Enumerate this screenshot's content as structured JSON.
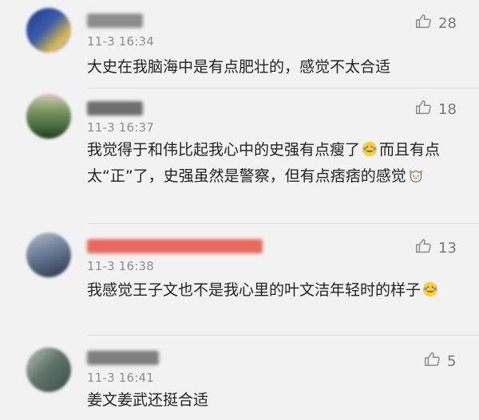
{
  "comments": [
    {
      "timestamp": "11-3 16:34",
      "likes": "28",
      "text": "大史在我脑海中是有点肥壮的，感觉不太合适",
      "avatar_colors": [
        "#1f3c8f",
        "#d9b855",
        "#8fb7e8"
      ],
      "username_color": "#8c8c8c"
    },
    {
      "timestamp": "11-3 16:37",
      "likes": "18",
      "text_parts": [
        "我觉得于和伟比起我心中的史强有点瘦了",
        "而且有点太“正”了，史强虽然是警察，但有点痞痞的感觉"
      ],
      "emoji_1": "laugh-cry-emoji",
      "emoji_2": "cat-emoji",
      "avatar_colors": [
        "#4b6f41",
        "#c5b3a3",
        "#243b24"
      ],
      "username_color": "#6f6f6f"
    },
    {
      "timestamp": "11-3 16:38",
      "likes": "13",
      "text_parts": [
        "我感觉王子文也不是我心里的叶文洁年轻时的样子"
      ],
      "emoji_1": "laugh-cry-emoji",
      "avatar_colors": [
        "#50607a",
        "#b7c0cc",
        "#2f3747"
      ],
      "username_color": "#e66a5c"
    },
    {
      "timestamp": "11-3 16:41",
      "likes": "5",
      "text": "姜文姜武还挺合适",
      "avatar_colors": [
        "#3a4d47",
        "#b9c3c1",
        "#62756d"
      ],
      "username_color": "#7f7f7f"
    }
  ]
}
